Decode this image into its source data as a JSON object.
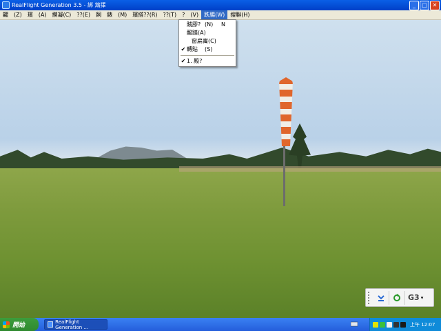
{
  "window": {
    "title": "RealFlight Generation 3.5 -   綁 鴆擇"
  },
  "menubar": {
    "items": [
      {
        "label": "糶"
      },
      {
        "label": "(Z)"
      },
      {
        "label": "璸"
      },
      {
        "label": "(A)"
      },
      {
        "label": "摸凝(C)"
      },
      {
        "label": "??(E)"
      },
      {
        "label": "飼"
      },
      {
        "label": "錶"
      },
      {
        "label": "(M)"
      },
      {
        "label": "璸搭??(R)"
      },
      {
        "label": "??(T)"
      },
      {
        "label": "?"
      },
      {
        "label": "(V)"
      },
      {
        "label": "跌腸(W)"
      },
      {
        "label": "搜聯(H)"
      }
    ]
  },
  "dropdown": {
    "items": [
      {
        "label": "賊膠?",
        "accel": "(N)",
        "shortcut": "N",
        "checked": false
      },
      {
        "label": "醱踏(A)",
        "accel": "",
        "shortcut": "",
        "checked": false
      },
      {
        "label": "窗扁寓(C)",
        "accel": "",
        "shortcut": "",
        "checked": false,
        "indent": true
      },
      {
        "label": "轉貼",
        "accel": "(S)",
        "shortcut": "",
        "checked": true
      },
      {
        "label": "1. 殿?",
        "accel": "",
        "shortcut": "",
        "checked": true
      }
    ]
  },
  "widget": {
    "g3_label": "G3"
  },
  "taskbar": {
    "start_label": "開始",
    "task_label": "RealFlight Generation ...",
    "clock": "上午 12:07"
  },
  "colors": {
    "titlebar": "#0a5fe6",
    "menu_highlight": "#316ac5",
    "windsock": "#e0662c"
  }
}
